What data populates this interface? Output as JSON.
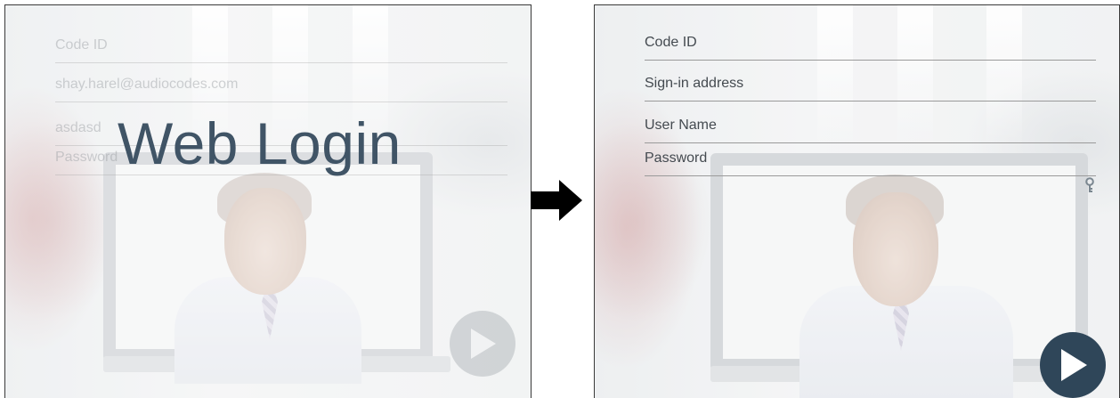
{
  "left_panel": {
    "overlay_title": "Web Login",
    "fields": [
      {
        "name": "code-id",
        "text": "Code ID"
      },
      {
        "name": "sign-in-address",
        "text": "shay.harel@audiocodes.com"
      },
      {
        "name": "user-name",
        "text": "asdasd"
      },
      {
        "name": "password",
        "text": "Password"
      }
    ],
    "submit_icon": "play-icon"
  },
  "transition": {
    "icon": "arrow-right-icon"
  },
  "right_panel": {
    "fields": [
      {
        "name": "code-id",
        "placeholder": "Code ID"
      },
      {
        "name": "sign-in-address",
        "placeholder": "Sign-in address"
      },
      {
        "name": "user-name",
        "placeholder": "User Name"
      },
      {
        "name": "password",
        "placeholder": "Password"
      }
    ],
    "password_toggle_icon": "key-icon",
    "submit_icon": "play-icon"
  },
  "colors": {
    "accent": "#2f4659",
    "title_text": "#405466",
    "field_text": "#444a50",
    "field_border": "#9a9a9a"
  }
}
